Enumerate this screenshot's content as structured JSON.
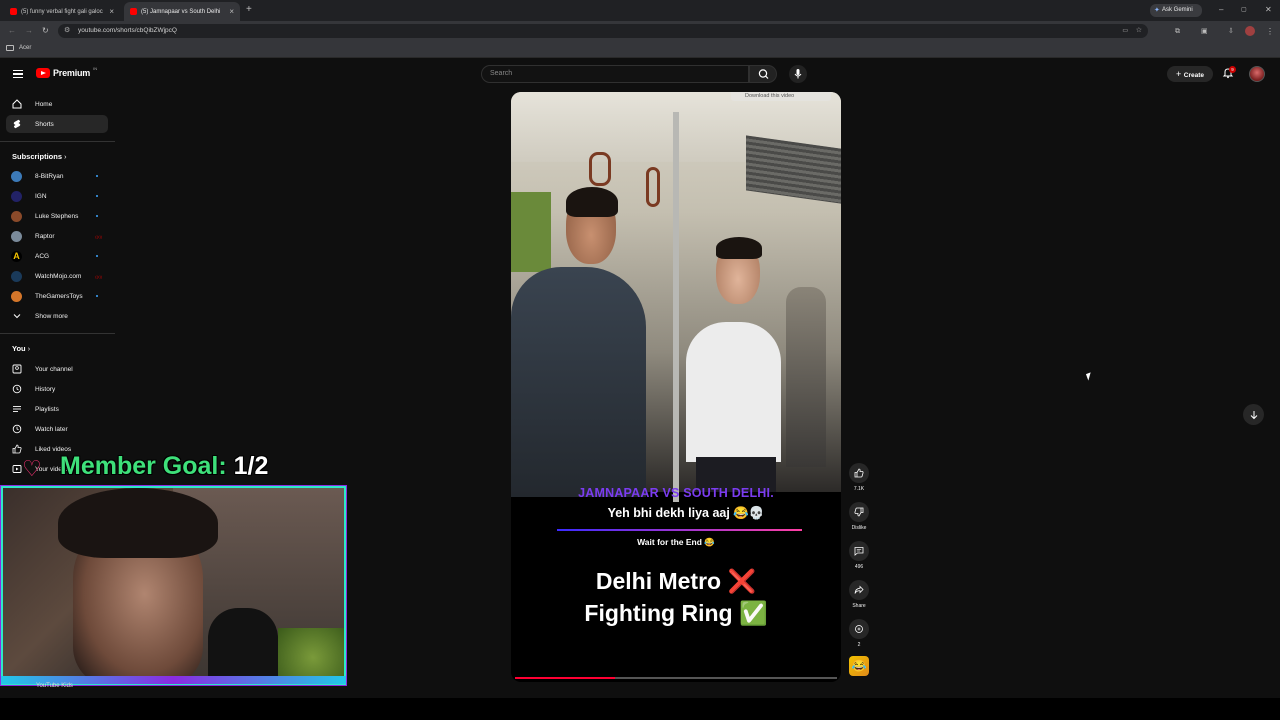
{
  "browser": {
    "tabs": [
      {
        "title": "(5) funny verbal fight gali galoc",
        "active": false
      },
      {
        "title": "(5) Jamnapaar vs South Delhi",
        "active": true
      }
    ],
    "new_tab": "+",
    "ask_gemini": "Ask Gemini",
    "url": "youtube.com/shorts/cbQibZWjpcQ",
    "bookmark": "Acer",
    "window_controls": [
      "–",
      "▢",
      "✕"
    ]
  },
  "header": {
    "logo_text": "Premium",
    "logo_sup": "IN",
    "search_placeholder": "Search",
    "create_label": "Create",
    "notification_count": "9"
  },
  "sidebar": {
    "main": [
      {
        "label": "Home",
        "icon": "home-icon"
      },
      {
        "label": "Shorts",
        "icon": "shorts-icon",
        "selected": true
      }
    ],
    "subscriptions_header": "Subscriptions",
    "subscriptions": [
      {
        "label": "8-BitRyan",
        "color": "#3c7ab8"
      },
      {
        "label": "IGN",
        "color": "#222266"
      },
      {
        "label": "Luke Stephens",
        "color": "#8a4a2a"
      },
      {
        "label": "Raptor",
        "color": "#7a8a9a"
      },
      {
        "label": "ACG",
        "color": "#000000"
      },
      {
        "label": "WatchMojo.com",
        "color": "#1a3a5a"
      },
      {
        "label": "TheGamersToys",
        "color": "#d4762a"
      }
    ],
    "show_more": "Show more",
    "you_header": "You",
    "you_items": [
      {
        "label": "Your channel",
        "icon": "channel-icon"
      },
      {
        "label": "History",
        "icon": "history-icon"
      },
      {
        "label": "Playlists",
        "icon": "playlist-icon"
      },
      {
        "label": "Watch later",
        "icon": "clock-icon"
      },
      {
        "label": "Liked videos",
        "icon": "like-icon"
      },
      {
        "label": "Your videos",
        "icon": "video-icon"
      }
    ],
    "youtube_kids": "YouTube Kids"
  },
  "video": {
    "overlay_text": "Download this video",
    "caption_title": "JAMNAPAAR VS SOUTH DELHI.",
    "caption_sub": "Yeh bhi dekh liya aaj 😂💀",
    "caption_wait": "Wait for the End 😂",
    "big_line1": "Delhi Metro ❌",
    "big_line2": "Fighting Ring ✅",
    "progress": 0.31
  },
  "actions": {
    "like_count": "7.1K",
    "dislike_label": "Dislike",
    "comment_count": "496",
    "share_label": "Share",
    "remix_count": "2"
  },
  "stream_overlay": {
    "goal_label": "Member Goal:",
    "goal_value": "1/2"
  }
}
